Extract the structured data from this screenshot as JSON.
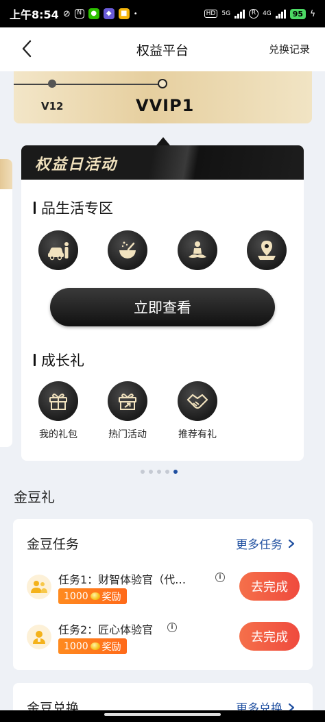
{
  "status_bar": {
    "time": "上午8:54",
    "network_label": "5G",
    "network2_label": "4G",
    "battery": "95"
  },
  "nav": {
    "title": "权益平台",
    "right_label": "兑换记录"
  },
  "level": {
    "current": "V12",
    "next": "VVIP1"
  },
  "activity": {
    "header_title": "权益日活动",
    "section1_title": "品生活专区",
    "section1_icons": [
      "car-service-icon",
      "food-bowl-icon",
      "yoga-meditation-icon",
      "location-pin-icon"
    ],
    "view_button": "立即查看",
    "section2_title": "成长礼",
    "section2_items": [
      {
        "label": "我的礼包",
        "icon": "gift-box-icon"
      },
      {
        "label": "热门活动",
        "icon": "gift-box-arrow-icon"
      },
      {
        "label": "推荐有礼",
        "icon": "handshake-icon"
      }
    ]
  },
  "carousel": {
    "count": 5,
    "active_index": 4
  },
  "golden_bean": {
    "heading": "金豆礼",
    "tasks_title": "金豆任务",
    "more_tasks": "更多任务",
    "tasks": [
      {
        "name": "任务1：财智体验官（代…",
        "reward_amount": "1000",
        "reward_label": "奖励",
        "button": "去完成"
      },
      {
        "name": "任务2：匠心体验官",
        "reward_amount": "1000",
        "reward_label": "奖励",
        "button": "去完成"
      }
    ],
    "exchange_title": "金豆兑换",
    "more_exchange": "更多兑换"
  },
  "colors": {
    "accent_blue": "#1f4fa0",
    "gold": "#e6cf9f",
    "orange": "#ff7a1f",
    "cta_red": "#ef4a3e"
  }
}
